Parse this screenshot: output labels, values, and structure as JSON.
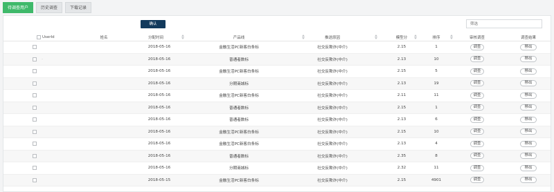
{
  "tabs": [
    {
      "label": "待调查用户",
      "active": true
    },
    {
      "label": "历史调查",
      "active": false
    },
    {
      "label": "下载记录",
      "active": false
    }
  ],
  "toolbar": {
    "confirm_label": "确认",
    "search_placeholder": "筛选"
  },
  "table": {
    "headers": {
      "userid": "UserId",
      "name": "姓名",
      "date": "分配时间",
      "product": "产品线",
      "reason": "推送原因",
      "score": "模型分",
      "rank": "排序",
      "action_investigate": "审核调查",
      "action_result": "调查结果"
    },
    "sortable_icon": "sort-icon",
    "button_investigate": "调查",
    "button_remove": "移出",
    "rows": [
      {
        "userid": "",
        "name": "",
        "date": "2018-05-16",
        "product": "金融生活PC新客白条标",
        "reason": "社交反欺诈(中介)",
        "score": "2.15",
        "rank": "1"
      },
      {
        "userid": "-",
        "name": "",
        "date": "2018-05-16",
        "product": "普通者数标",
        "reason": "社交反欺诈(中介)",
        "score": "2.13",
        "rank": "10"
      },
      {
        "userid": "",
        "name": "",
        "date": "2018-05-16",
        "product": "金融生活PC新客白条标",
        "reason": "社交反欺诈(中介)",
        "score": "2.15",
        "rank": "5"
      },
      {
        "userid": "",
        "name": "",
        "date": "2018-05-16",
        "product": "分期商城标",
        "reason": "社交反欺诈(中介)",
        "score": "2.13",
        "rank": "19"
      },
      {
        "userid": "",
        "name": "",
        "date": "2018-05-16",
        "product": "金融生活PC新客白条标",
        "reason": "社交反欺诈(中介)",
        "score": "2.11",
        "rank": "11"
      },
      {
        "userid": "",
        "name": "",
        "date": "2018-05-16",
        "product": "普通者数标",
        "reason": "社交反欺诈(中介)",
        "score": "2.15",
        "rank": "1"
      },
      {
        "userid": "",
        "name": "",
        "date": "2018-05-16",
        "product": "普通者数标",
        "reason": "社交反欺诈(中介)",
        "score": "2.13",
        "rank": "6"
      },
      {
        "userid": "",
        "name": "",
        "date": "2018-05-16",
        "product": "金融生活PC新客白条标",
        "reason": "社交反欺诈(中介)",
        "score": "2.15",
        "rank": "10"
      },
      {
        "userid": "",
        "name": "",
        "date": "2018-05-16",
        "product": "金融生活PC新客白条标",
        "reason": "社交反欺诈(中介)",
        "score": "2.13",
        "rank": "4"
      },
      {
        "userid": "",
        "name": "",
        "date": "2018-05-16",
        "product": "普通者数标",
        "reason": "社交反欺诈(中介)",
        "score": "2.35",
        "rank": "8"
      },
      {
        "userid": "",
        "name": "",
        "date": "2018-05-16",
        "product": "分期商城标",
        "reason": "社交反欺诈(中介)",
        "score": "2.32",
        "rank": "11"
      },
      {
        "userid": "",
        "name": "",
        "date": "2018-05-15",
        "product": "金融生活PC新客白条标",
        "reason": "社交反欺诈(中介)",
        "score": "2.15",
        "rank": "4901"
      }
    ]
  },
  "colors": {
    "accent": "#3fb96a",
    "confirm_bg": "#123a5c"
  }
}
